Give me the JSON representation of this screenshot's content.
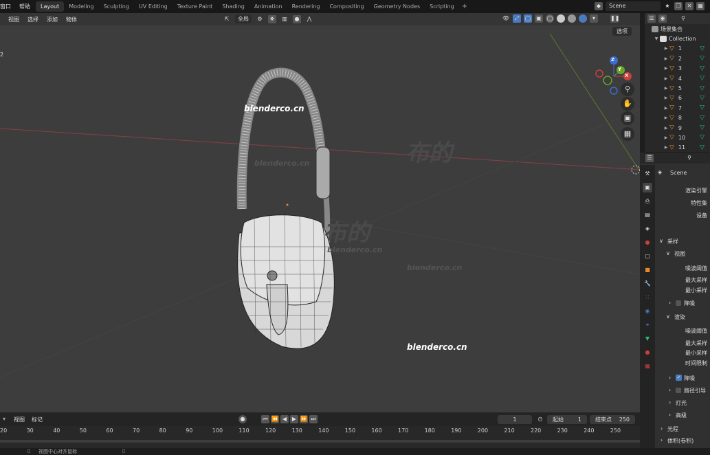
{
  "topbar": {
    "menu": [
      "窗口",
      "帮助"
    ],
    "tabs": [
      "Layout",
      "Modeling",
      "Sculpting",
      "UV Editing",
      "Texture Paint",
      "Shading",
      "Animation",
      "Rendering",
      "Compositing",
      "Geometry Nodes",
      "Scripting"
    ],
    "active_tab": "Layout",
    "plus": "+",
    "scene_name": "Scene"
  },
  "viewport": {
    "menu": [
      "视图",
      "选择",
      "添加",
      "物体"
    ],
    "orientation": "全局",
    "options_label": "选项",
    "corner_number": "2",
    "watermarks": [
      "blenderco.cn",
      "blenderco.cn",
      "blenderco.cn",
      "blenderco.cn",
      "blenderco.cn",
      "布的",
      "布的"
    ],
    "gizmo": {
      "z": "Z",
      "y": "Y",
      "x": "X"
    }
  },
  "outliner": {
    "scene_collection": "场景集合",
    "collection": "Collection",
    "items": [
      "1",
      "2",
      "3",
      "4",
      "5",
      "6",
      "7",
      "8",
      "9",
      "10",
      "11"
    ]
  },
  "properties": {
    "scene_label": "Scene",
    "render_engine": "渲染引擎",
    "feature_set": "特性集",
    "device": "设备",
    "sampling": "采样",
    "viewport": "视图",
    "noise_threshold": "噪波阈值",
    "max_samples": "最大采样",
    "min_samples": "最小采样",
    "denoise": "降噪",
    "render": "渲染",
    "render_noise_threshold": "噪波阈值",
    "render_max_samples": "最大采样",
    "render_min_samples": "最小采样",
    "time_limit": "时间限制",
    "render_denoise": "降噪",
    "path_guiding": "路径引导",
    "lights": "灯光",
    "advanced": "高级",
    "light_paths": "光程",
    "volumes": "体积(卷积)"
  },
  "timeline": {
    "menu": [
      "视图",
      "标记"
    ],
    "current_frame": "1",
    "start_label": "起始",
    "start_value": "1",
    "end_label": "结束点",
    "end_value": "250",
    "ticks": [
      "20",
      "30",
      "40",
      "50",
      "60",
      "70",
      "80",
      "90",
      "100",
      "110",
      "120",
      "130",
      "140",
      "150",
      "160",
      "170",
      "180",
      "190",
      "200",
      "210",
      "220",
      "230",
      "240",
      "250"
    ]
  },
  "status": {
    "hint": "视图中心对齐鼠标"
  },
  "colors": {
    "accent": "#4a7bbf",
    "active_tab_bg": "#303030",
    "viewport_bg": "#3d3d3d"
  }
}
